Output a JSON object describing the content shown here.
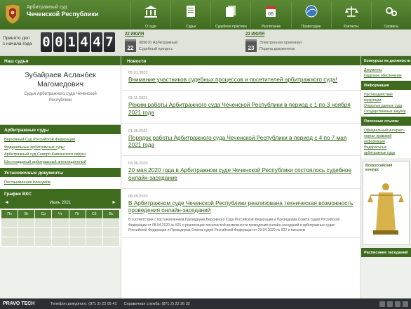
{
  "header": {
    "court_line1": "Арбитражный суд",
    "court_line2": "Чеченской Республики",
    "nav": [
      {
        "label": "О суде",
        "icon": "building-icon"
      },
      {
        "label": "Судьи",
        "icon": "document-icon"
      },
      {
        "label": "Судебная практика",
        "icon": "papers-icon"
      },
      {
        "label": "Расписание",
        "icon": "calendar-icon"
      },
      {
        "label": "Правосудие",
        "icon": "globe-icon"
      },
      {
        "label": "Контакты",
        "icon": "scales-icon"
      },
      {
        "label": "Сервисы",
        "icon": "gears-icon"
      }
    ]
  },
  "counter": {
    "label_line1": "Принято дел",
    "label_line2": "с начала года",
    "digits": [
      "0",
      "0",
      "1",
      "4",
      "4",
      "7"
    ]
  },
  "calendar_blocks": [
    {
      "date": "22 ИЮЛЯ",
      "day": "22",
      "line1": "009670 Арбитражный",
      "line2": "Судебный процесс"
    },
    {
      "date": "23 ИЮЛЯ",
      "day": "23",
      "line1": "Электронная приемная",
      "line2": "Подача документов"
    }
  ],
  "left": {
    "judge_head": "Наш судья",
    "judge_name_1": "Зубайраев Асланбек",
    "judge_name_2": "Магомедович",
    "judge_pos_1": "Судья Арбитражного суда Чеченской",
    "judge_pos_2": "Республики",
    "courts_head": "Арбитражные суды",
    "courts": [
      "Верховный Суд Российской Федерации",
      "Федеральные арбитражные суды",
      "Арбитражный суд Северо-Кавказского округа",
      "Шестнадцатый арбитражный апелляционный"
    ],
    "practice_head": "Установочные документы",
    "practice": [
      "Постановления пленумов"
    ],
    "calendar_head": "График ВКС",
    "calendar_month": "Июль 2021",
    "calendar_days": [
      "Пн",
      "Вт",
      "Ср",
      "Чт",
      "Пт",
      "Сб",
      "Вс"
    ]
  },
  "news": {
    "head": "Новости",
    "items": [
      {
        "date": "05.01.2022",
        "title": "Внимание участников судебных процессов и посетителей арбитражного суда!"
      },
      {
        "date": "01.11.2021",
        "title": "Режим работы Арбитражного суда Чеченской Республики в период с 1 по 3 ноября 2021 года"
      },
      {
        "date": "01.05.2021",
        "title": "Порядок работы Арбитражного суда Чеченской Республики в период с 4 по 7 мая 2021 года"
      },
      {
        "date": "03.06.2020",
        "title": "20 мая 2020 года в Арбитражном суде Чеченской Республики состоялось судебное онлайн-заседание"
      },
      {
        "date": "08.05.2020",
        "title": "В Арбитражном суде Чеченской Республики реализована техническая возможность проведения онлайн-заседаний",
        "body": "В соответствии с постановлением Президиума Верховного Суда Российской Федерации и Президиума Совета судей Российской Федерации от 08.04.2020 № 821 о реализации технической возможности проведения онлайн-заседаний в арбитражных судах Российской Федерации и Президиума Совета судей Российской Федерации от 29.04.2020 № 822 и письмом"
      }
    ]
  },
  "right": {
    "head1": "Конкурсы на должности",
    "links1": [
      "Документы",
      "Кадровое обеспечение"
    ],
    "head2": "Информация",
    "links2": [
      "Противодействие коррупции",
      "Открытые данные суда",
      "Государственные закупки"
    ],
    "head3": "Полезные ссылки",
    "links3": [
      "Официальный интернет-портал правовой информации",
      "Федеральные арбитражные суды"
    ],
    "themis_label": "Всероссийский конкурс",
    "head4": "Расписание заседаний"
  },
  "footer": {
    "brand": "PRAVO TECH",
    "phone1": "Телефон дежурного: (871 2) 22 05 41",
    "phone2": "Справочная служба: (871 2) 22 26 32"
  }
}
